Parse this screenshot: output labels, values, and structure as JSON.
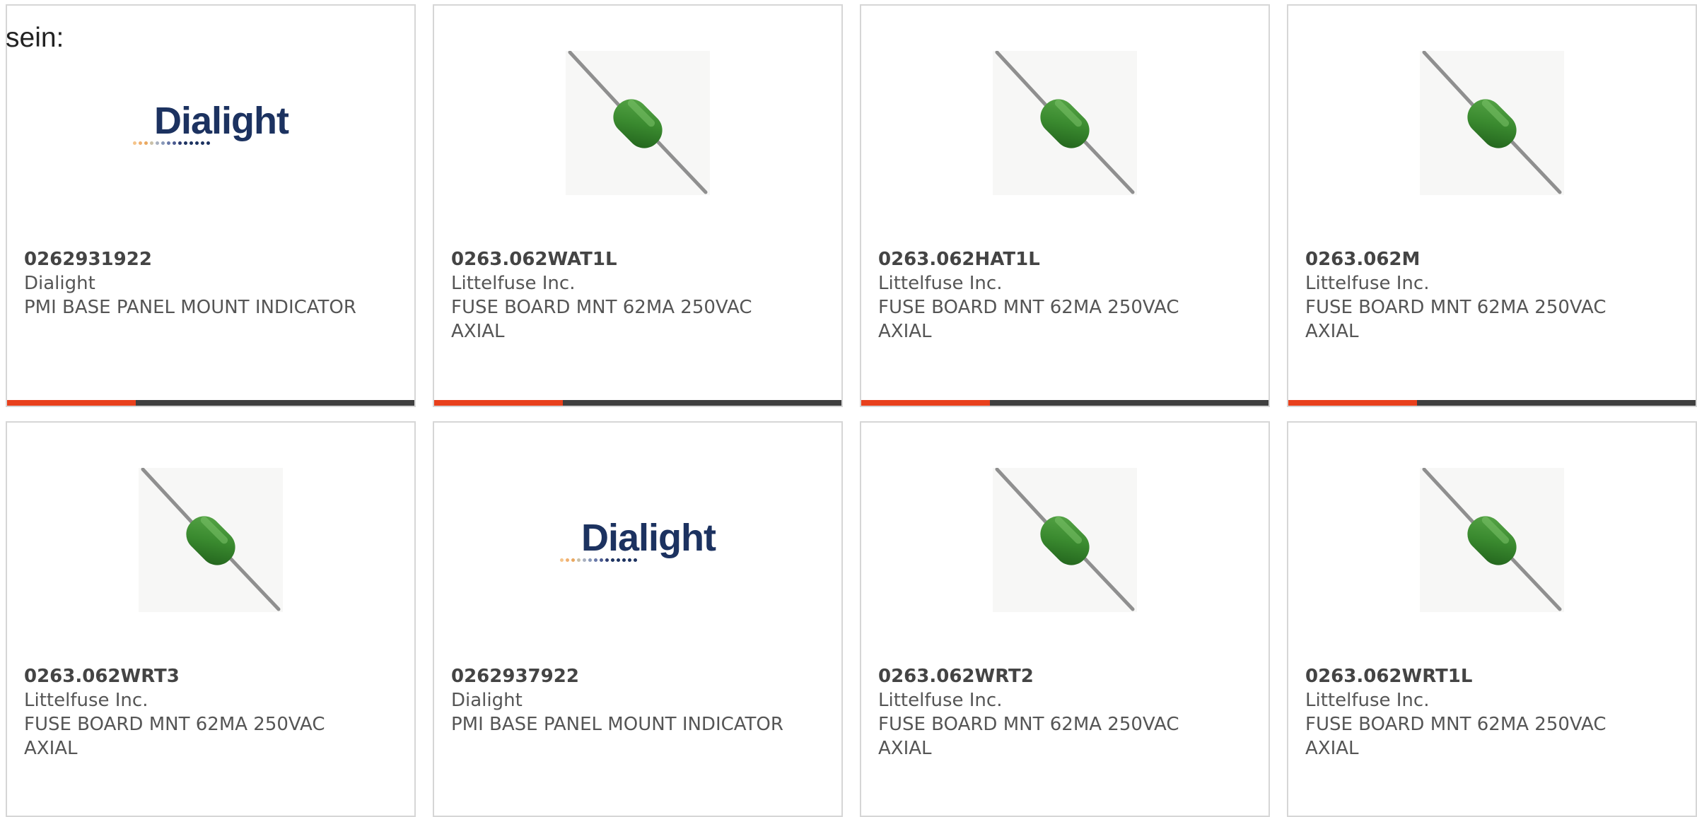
{
  "intro_text": "sein:",
  "brand_logo_text": "Dialight",
  "colors": {
    "accent_bar": "#e8401c",
    "base_bar": "#3f3f3f",
    "card_border": "#d6d6d6",
    "logo_navy": "#1c3260",
    "fuse_green": "#3a8a2f"
  },
  "products": [
    {
      "part_number": "0262931922",
      "manufacturer": "Dialight",
      "description": "PMI BASE PANEL MOUNT INDICATOR",
      "image": "dialight-logo"
    },
    {
      "part_number": "0263.062WAT1L",
      "manufacturer": "Littelfuse Inc.",
      "description": "FUSE BOARD MNT 62MA 250VAC AXIAL",
      "image": "fuse-photo"
    },
    {
      "part_number": "0263.062HAT1L",
      "manufacturer": "Littelfuse Inc.",
      "description": "FUSE BOARD MNT 62MA 250VAC AXIAL",
      "image": "fuse-photo"
    },
    {
      "part_number": "0263.062M",
      "manufacturer": "Littelfuse Inc.",
      "description": "FUSE BOARD MNT 62MA 250VAC AXIAL",
      "image": "fuse-photo"
    },
    {
      "part_number": "0263.062WRT3",
      "manufacturer": "Littelfuse Inc.",
      "description": "FUSE BOARD MNT 62MA 250VAC AXIAL",
      "image": "fuse-photo"
    },
    {
      "part_number": "0262937922",
      "manufacturer": "Dialight",
      "description": "PMI BASE PANEL MOUNT INDICATOR",
      "image": "dialight-logo"
    },
    {
      "part_number": "0263.062WRT2",
      "manufacturer": "Littelfuse Inc.",
      "description": "FUSE BOARD MNT 62MA 250VAC AXIAL",
      "image": "fuse-photo"
    },
    {
      "part_number": "0263.062WRT1L",
      "manufacturer": "Littelfuse Inc.",
      "description": "FUSE BOARD MNT 62MA 250VAC AXIAL",
      "image": "fuse-photo"
    }
  ]
}
